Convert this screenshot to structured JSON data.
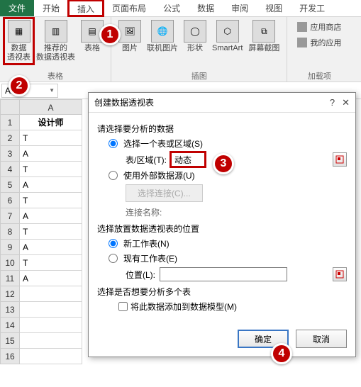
{
  "tabs": {
    "file": "文件",
    "home": "开始",
    "insert": "插入",
    "layout": "页面布局",
    "formula": "公式",
    "data": "数据",
    "review": "审阅",
    "view": "视图",
    "dev": "开发工"
  },
  "ribbon": {
    "pivot": "数据\n透视表",
    "pivot_rec": "推荐的\n数据透视表",
    "pivot_group_label": "表格",
    "table": "表格",
    "picture": "图片",
    "online_pic": "联机图片",
    "shapes": "形状",
    "smartart": "SmartArt",
    "screenshot": "屏幕截图",
    "illust_group_label": "插图",
    "store": "应用商店",
    "myapps": "我的应用",
    "addin_group_label": "加载项"
  },
  "namebox": "A1",
  "grid": {
    "colA": "A",
    "header": "设计师",
    "rows": [
      "T",
      "A",
      "T",
      "A",
      "T",
      "A",
      "T",
      "A",
      "T",
      "A",
      "",
      "",
      "",
      "",
      ""
    ]
  },
  "dialog": {
    "title": "创建数据透视表",
    "section_analyze": "请选择要分析的数据",
    "opt_table": "选择一个表或区域(S)",
    "label_range": "表/区域(T):",
    "value_range": "动态",
    "opt_external": "使用外部数据源(U)",
    "btn_conn": "选择连接(C)...",
    "label_conn_name": "连接名称:",
    "section_place": "选择放置数据透视表的位置",
    "opt_newsheet": "新工作表(N)",
    "opt_existing": "现有工作表(E)",
    "label_location": "位置(L):",
    "section_multi": "选择是否想要分析多个表",
    "check_model": "将此数据添加到数据模型(M)",
    "ok": "确定",
    "cancel": "取消"
  },
  "badges": {
    "b1": "1",
    "b2": "2",
    "b3": "3",
    "b4": "4"
  }
}
